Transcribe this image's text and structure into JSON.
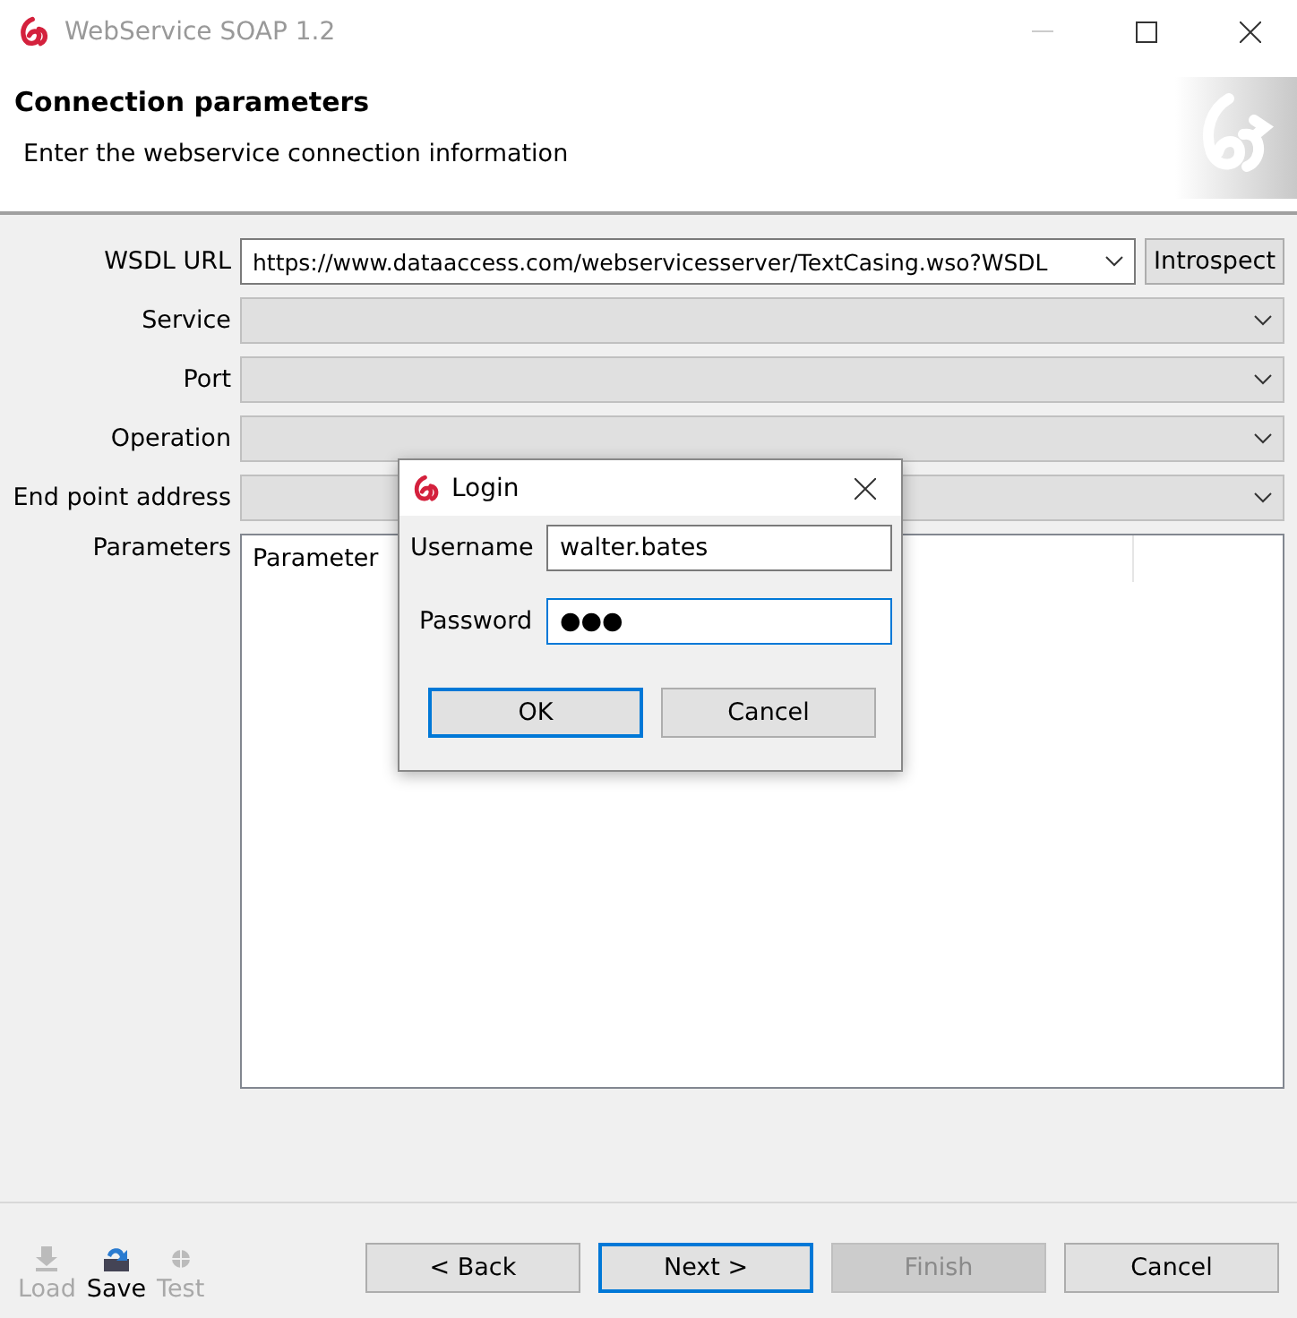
{
  "window": {
    "title": "WebService SOAP 1.2"
  },
  "header": {
    "title": "Connection parameters",
    "subtitle": "Enter the webservice connection information"
  },
  "form": {
    "fields": [
      {
        "label": "WSDL URL",
        "value": "https://www.dataaccess.com/webservicesserver/TextCasing.wso?WSDL",
        "disabled": false
      },
      {
        "label": "Service",
        "disabled": true
      },
      {
        "label": "Port",
        "disabled": true
      },
      {
        "label": "Operation",
        "disabled": true
      },
      {
        "label": "End point address",
        "disabled": true
      }
    ],
    "introspect_button": "Introspect",
    "parameters": {
      "label": "Parameters",
      "columns": [
        "Parameter"
      ]
    }
  },
  "login_dialog": {
    "title": "Login",
    "username": {
      "label": "Username",
      "value": "walter.bates"
    },
    "password": {
      "label": "Password",
      "value": "●●●"
    },
    "buttons": [
      {
        "label": "OK",
        "focused": true
      },
      {
        "label": "Cancel",
        "focused": false
      }
    ]
  },
  "toolbar": [
    {
      "label": "Load",
      "kind": "load",
      "disabled": true
    },
    {
      "label": "Save",
      "kind": "save",
      "disabled": false
    },
    {
      "label": "Test",
      "kind": "test",
      "disabled": true
    }
  ],
  "buttons": [
    {
      "label": "< Back",
      "focused": false,
      "disabled": false
    },
    {
      "label": "Next >",
      "focused": true,
      "disabled": false
    },
    {
      "label": "Finish",
      "focused": false,
      "disabled": true
    },
    {
      "label": "Cancel",
      "focused": false,
      "disabled": false
    }
  ]
}
